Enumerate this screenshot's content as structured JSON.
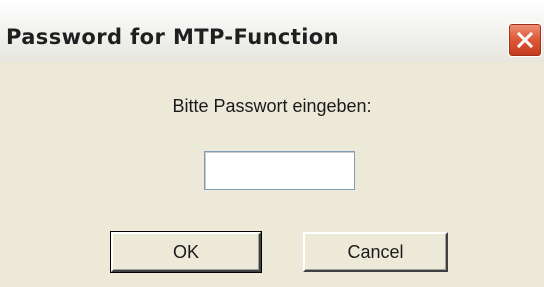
{
  "window": {
    "title": "Password for MTP-Function"
  },
  "dialog": {
    "prompt": "Bitte Passwort eingeben:",
    "password_value": "",
    "ok_label": "OK",
    "cancel_label": "Cancel"
  },
  "icons": {
    "close": "close-icon"
  },
  "colors": {
    "dialog_background": "#ece9d8",
    "close_button": "#de5b3b"
  }
}
